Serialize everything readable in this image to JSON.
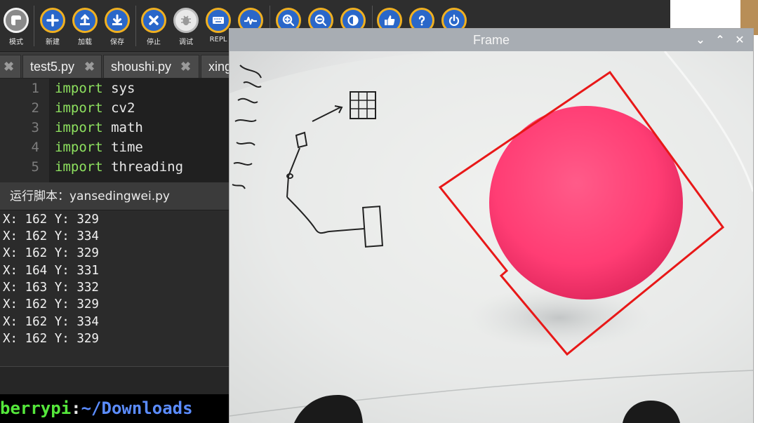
{
  "toolbar": {
    "buttons": [
      {
        "id": "mode",
        "label": "模式",
        "icon": "mode-icon"
      },
      {
        "id": "new",
        "label": "新建",
        "icon": "plus-icon"
      },
      {
        "id": "load",
        "label": "加载",
        "icon": "upload-icon"
      },
      {
        "id": "save",
        "label": "保存",
        "icon": "download-icon"
      },
      {
        "id": "stop",
        "label": "停止",
        "icon": "close-icon"
      },
      {
        "id": "debug",
        "label": "调试",
        "icon": "bug-icon"
      },
      {
        "id": "repl",
        "label": "REPL",
        "icon": "keyboard-icon"
      },
      {
        "id": "plotter",
        "label": "",
        "icon": "pulse-icon"
      },
      {
        "id": "zoom_in",
        "label": "",
        "icon": "zoom-in-icon"
      },
      {
        "id": "zoom_out",
        "label": "",
        "icon": "zoom-out-icon"
      },
      {
        "id": "theme",
        "label": "",
        "icon": "contrast-icon"
      },
      {
        "id": "check",
        "label": "",
        "icon": "thumbs-up-icon"
      },
      {
        "id": "help",
        "label": "",
        "icon": "help-icon"
      },
      {
        "id": "quit",
        "label": "",
        "icon": "power-icon"
      }
    ]
  },
  "tabs": [
    {
      "label": "test5.py"
    },
    {
      "label": "shoushi.py"
    },
    {
      "label": "xing"
    }
  ],
  "editor": {
    "lines": [
      {
        "num": "1",
        "keyword": "import",
        "module": "sys"
      },
      {
        "num": "2",
        "keyword": "import",
        "module": "cv2"
      },
      {
        "num": "3",
        "keyword": "import",
        "module": "math"
      },
      {
        "num": "4",
        "keyword": "import",
        "module": "time"
      },
      {
        "num": "5",
        "keyword": "import",
        "module": "threading"
      }
    ]
  },
  "run_panel": {
    "title": "运行脚本：yansedingwei.py",
    "output": [
      "X: 162 Y: 329",
      "X: 162 Y: 334",
      "X: 162 Y: 329",
      "X: 164 Y: 331",
      "X: 163 Y: 332",
      "X: 162 Y: 329",
      "X: 162 Y: 334",
      "X: 162 Y: 329"
    ]
  },
  "terminal": {
    "host": "berrypi",
    "colon": ":",
    "path": "~/Downloads"
  },
  "frame_window": {
    "title": "Frame",
    "controls": {
      "menu": "⌄",
      "minimize": "⌃",
      "close": "✕"
    }
  },
  "colors": {
    "ball": "#ff3d74",
    "detection_box": "#e81818",
    "keyword": "#8ee15f",
    "terminal_host": "#55e83b",
    "terminal_path": "#5b8cff"
  }
}
